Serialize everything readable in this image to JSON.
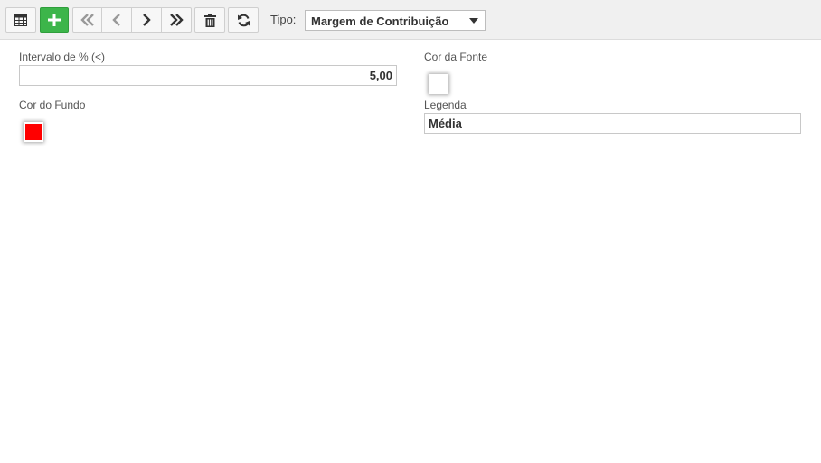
{
  "toolbar": {
    "buttons": [
      {
        "name": "grid-view-button",
        "icon": "table-icon"
      },
      {
        "name": "add-button",
        "icon": "plus-icon"
      },
      {
        "name": "first-record-button",
        "icon": "double-chevron-left-icon"
      },
      {
        "name": "previous-record-button",
        "icon": "chevron-left-icon"
      },
      {
        "name": "next-record-button",
        "icon": "chevron-right-icon"
      },
      {
        "name": "last-record-button",
        "icon": "double-chevron-right-icon"
      },
      {
        "name": "delete-button",
        "icon": "trash-icon"
      },
      {
        "name": "refresh-button",
        "icon": "refresh-icon"
      }
    ],
    "tipo_label": "Tipo:",
    "tipo_value": "Margem de Contribuição"
  },
  "form": {
    "interval_label": "Intervalo de % (<)",
    "interval_value": "5,00",
    "font_color_label": "Cor da Fonte",
    "font_color": "#ffffff",
    "bg_color_label": "Cor do Fundo",
    "bg_color": "#ff0000",
    "legend_label": "Legenda",
    "legend_value": "Média"
  },
  "colors": {
    "add_button": "#3cb54a",
    "toolbar_bg": "#f0f0f0"
  }
}
